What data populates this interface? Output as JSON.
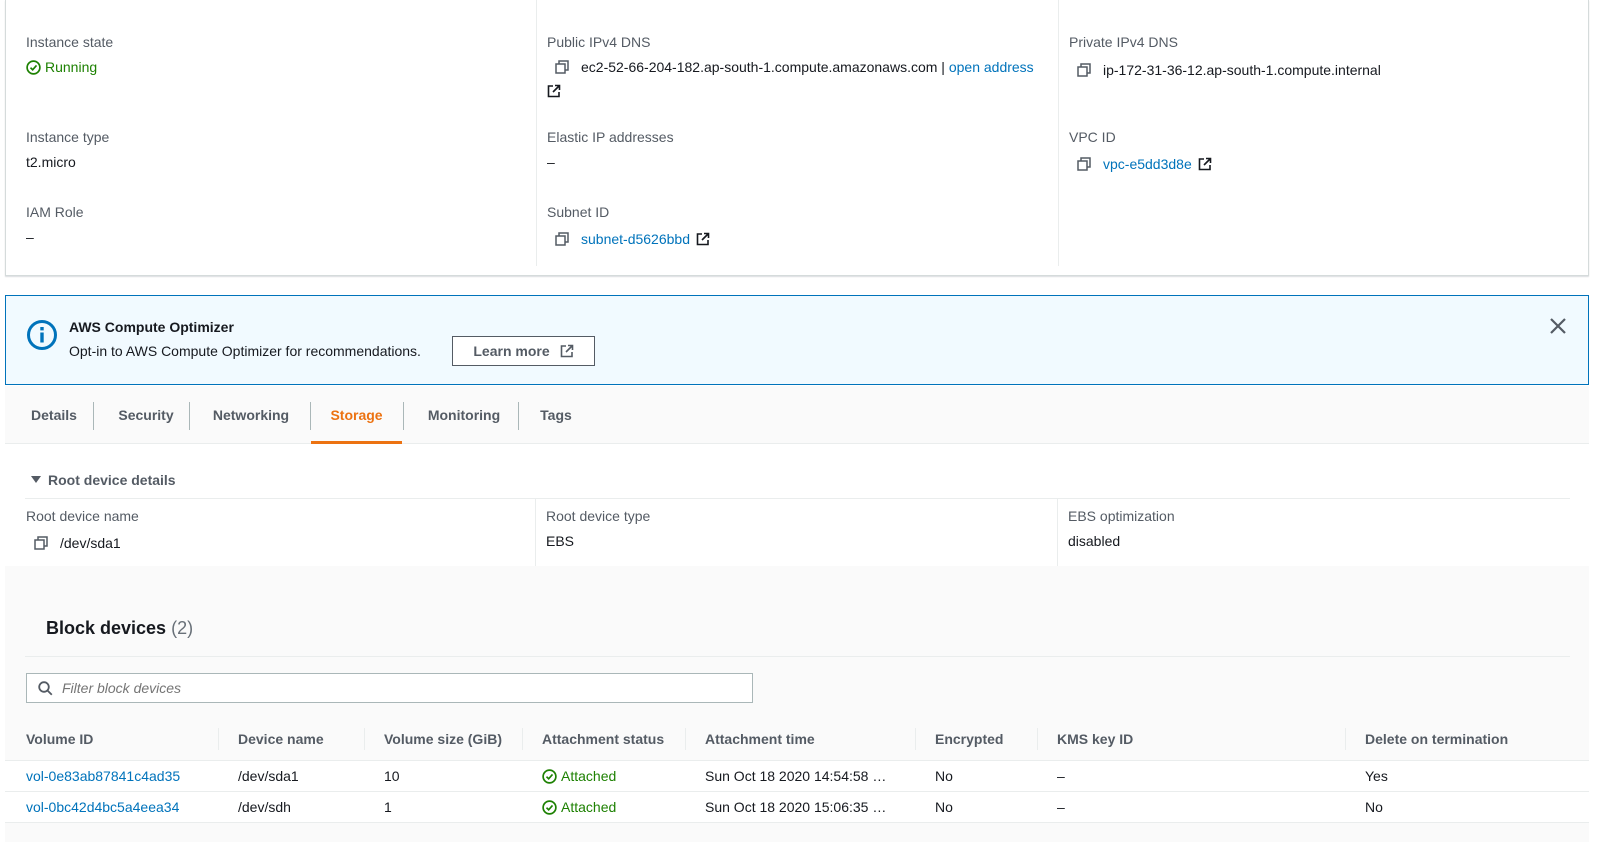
{
  "summary": {
    "col1": {
      "instance_state_label": "Instance state",
      "instance_state_value": "Running",
      "instance_type_label": "Instance type",
      "instance_type_value": "t2.micro",
      "iam_role_label": "IAM Role",
      "iam_role_value": "–"
    },
    "col2": {
      "public_dns_label": "Public IPv4 DNS",
      "public_dns_value": "ec2-52-66-204-182.ap-south-1.compute.amazonaws.com",
      "public_dns_sep": " | ",
      "open_address": "open address",
      "elastic_ip_label": "Elastic IP addresses",
      "elastic_ip_value": "–",
      "subnet_label": "Subnet ID",
      "subnet_value": "subnet-d5626bbd"
    },
    "col3": {
      "private_dns_label": "Private IPv4 DNS",
      "private_dns_value": "ip-172-31-36-12.ap-south-1.compute.internal",
      "vpc_label": "VPC ID",
      "vpc_value": "vpc-e5dd3d8e"
    }
  },
  "banner": {
    "title": "AWS Compute Optimizer",
    "text": "Opt-in to AWS Compute Optimizer for recommendations.",
    "learn_more": "Learn more"
  },
  "tabs": [
    {
      "label": "Details"
    },
    {
      "label": "Security"
    },
    {
      "label": "Networking"
    },
    {
      "label": "Storage"
    },
    {
      "label": "Monitoring"
    },
    {
      "label": "Tags"
    }
  ],
  "root_device": {
    "heading": "Root device details",
    "name_label": "Root device name",
    "name_value": "/dev/sda1",
    "type_label": "Root device type",
    "type_value": "EBS",
    "ebs_label": "EBS optimization",
    "ebs_value": "disabled"
  },
  "block_devices": {
    "title": "Block devices",
    "count": "(2)",
    "filter_placeholder": "Filter block devices",
    "columns": [
      "Volume ID",
      "Device name",
      "Volume size (GiB)",
      "Attachment status",
      "Attachment time",
      "Encrypted",
      "KMS key ID",
      "Delete on termination"
    ],
    "rows": [
      {
        "volume_id": "vol-0e83ab87841c4ad35",
        "device": "/dev/sda1",
        "size": "10",
        "status": "Attached",
        "time": "Sun Oct 18 2020 14:54:58 …",
        "encrypted": "No",
        "kms": "–",
        "delete": "Yes"
      },
      {
        "volume_id": "vol-0bc42d4bc5a4eea34",
        "device": "/dev/sdh",
        "size": "1",
        "status": "Attached",
        "time": "Sun Oct 18 2020 15:06:35 …",
        "encrypted": "No",
        "kms": "–",
        "delete": "No"
      }
    ]
  },
  "colors": {
    "accent": "#ec7211",
    "link": "#0073bb",
    "success": "#1d8102"
  }
}
